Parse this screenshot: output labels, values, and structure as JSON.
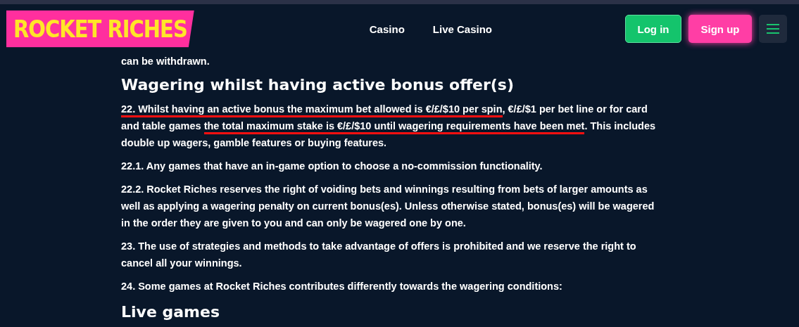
{
  "header": {
    "logo": "ROCKET RICHES",
    "nav": [
      {
        "label": "Casino"
      },
      {
        "label": "Live Casino"
      }
    ],
    "login": "Log in",
    "signup": "Sign up"
  },
  "intro": "can be withdrawn.",
  "blocks": [
    {
      "kind": "heading",
      "text": "Wagering whilst having active bonus offer(s)"
    },
    {
      "kind": "paragraph",
      "segments": [
        {
          "text": "22. Whilst having an active bonus the maximum bet allowed is €/£/$10 per spin",
          "underlined": true
        },
        {
          "text": ", €/£/$1 per bet line or for card and table games ",
          "underlined": false
        },
        {
          "text": "the total maximum stake is €/£/$10 until wagering requirements have been met",
          "underlined": true
        },
        {
          "text": ". This includes double up wagers, gamble features or buying features.",
          "underlined": false
        }
      ]
    },
    {
      "kind": "paragraph",
      "segments": [
        {
          "text": "22.1. Any games that have an in-game option to choose a no-commission functionality.",
          "underlined": false
        }
      ]
    },
    {
      "kind": "paragraph",
      "segments": [
        {
          "text": "22.2. Rocket Riches reserves the right of voiding bets and winnings resulting from bets of larger amounts as well as applying a wagering penalty on current bonus(es). Unless otherwise stated, bonus(es) will be wagered in the order they are given to you and can only be wagered one by one.",
          "underlined": false
        }
      ]
    },
    {
      "kind": "paragraph",
      "segments": [
        {
          "text": "23. The use of strategies and methods to take advantage of offers is prohibited and we reserve the right to cancel all your winnings.",
          "underlined": false
        }
      ]
    },
    {
      "kind": "paragraph",
      "segments": [
        {
          "text": "24. Some games at Rocket Riches contributes differently towards the wagering conditions:",
          "underlined": false
        }
      ]
    },
    {
      "kind": "heading",
      "text": "Live games"
    }
  ]
}
